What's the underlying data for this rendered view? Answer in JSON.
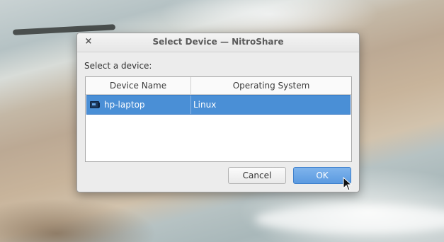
{
  "window": {
    "title": "Select Device — NitroShare",
    "close_glyph": "×"
  },
  "prompt": "Select a device:",
  "table": {
    "columns": [
      "Device Name",
      "Operating System"
    ],
    "rows": [
      {
        "icon": "device-icon",
        "name": "hp-laptop",
        "os": "Linux",
        "selected": true
      }
    ]
  },
  "buttons": {
    "cancel_label": "Cancel",
    "ok_label": "OK"
  },
  "colors": {
    "selection": "#4a8fd6",
    "ok_button": "#5b9ae0"
  }
}
